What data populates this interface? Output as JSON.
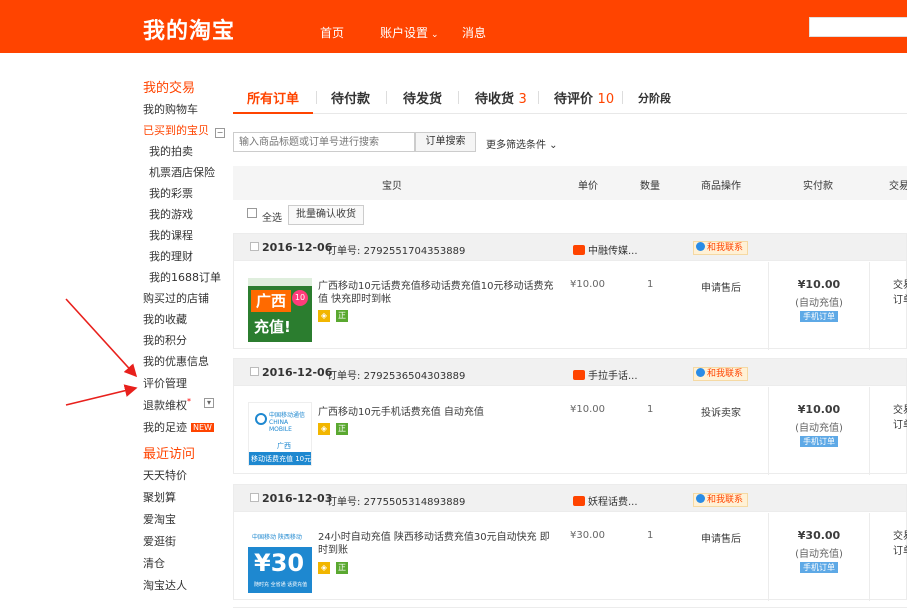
{
  "header": {
    "brand": "我的淘宝",
    "nav": [
      {
        "label": "首页",
        "arrow": ""
      },
      {
        "label": "账户设置",
        "arrow": "⌄"
      },
      {
        "label": "消息",
        "arrow": ""
      }
    ],
    "accent_color": "#ff4400"
  },
  "sidebar": {
    "trade_heading": "我的交易",
    "items": [
      {
        "label": "我的购物车"
      },
      {
        "label": "已买到的宝贝"
      },
      {
        "label": "我的拍卖"
      },
      {
        "label": "机票酒店保险"
      },
      {
        "label": "我的彩票"
      },
      {
        "label": "我的游戏"
      },
      {
        "label": "我的课程"
      },
      {
        "label": "我的理财"
      },
      {
        "label": "我的1688订单"
      },
      {
        "label": "购买过的店铺"
      },
      {
        "label": "我的收藏"
      },
      {
        "label": "我的积分"
      },
      {
        "label": "我的优惠信息"
      },
      {
        "label": "评价管理"
      },
      {
        "label": "退款维权"
      },
      {
        "label": "我的足迹"
      }
    ],
    "collapse_icon": "−",
    "expand_icon": "▾",
    "new_badge": "NEW",
    "recent_heading": "最近访问",
    "recent": [
      {
        "label": "天天特价"
      },
      {
        "label": "聚划算"
      },
      {
        "label": "爱淘宝"
      },
      {
        "label": "爱逛街"
      },
      {
        "label": "清仓"
      },
      {
        "label": "淘宝达人"
      }
    ]
  },
  "tabs": [
    {
      "label": "所有订单",
      "count": ""
    },
    {
      "label": "待付款",
      "count": ""
    },
    {
      "label": "待发货",
      "count": ""
    },
    {
      "label": "待收货",
      "count": "3"
    },
    {
      "label": "待评价",
      "count": "10"
    },
    {
      "label": "分阶段",
      "count": ""
    }
  ],
  "search": {
    "placeholder": "输入商品标题或订单号进行搜索",
    "button": "订单搜索",
    "more_filters": "更多筛选条件 ⌄"
  },
  "table_header": [
    "宝贝",
    "单价",
    "数量",
    "商品操作",
    "实付款",
    "交易"
  ],
  "select_all": "全选",
  "bulk_confirm": "批量确认收货",
  "order_no_label": "订单号:",
  "contact_label": "和我联系",
  "mobile_order_label": "手机订单",
  "orders": [
    {
      "date": "2016-12-06",
      "order_no": "2792551704353889",
      "shop": "中融传媒...",
      "title": "广西移动10元话费充值移动话费充值10元移动话费充值 快充即时到帐",
      "price": "¥10.00",
      "qty": "1",
      "op": "申请售后",
      "paid": "¥10.00",
      "auto": "(自动充值)",
      "status": [
        "交易",
        "订单"
      ],
      "thumb": {
        "line1": "广西",
        "badge": "10",
        "line2": "充值!"
      }
    },
    {
      "date": "2016-12-06",
      "order_no": "2792536504303889",
      "shop": "手拉手话...",
      "title": "广西移动10元手机话费充值 自动充值",
      "price": "¥10.00",
      "qty": "1",
      "op": "投诉卖家",
      "paid": "¥10.00",
      "auto": "(自动充值)",
      "status": [
        "交易",
        "订单"
      ],
      "thumb": {
        "brand": "中国移动通信 CHINA MOBILE",
        "region": "广西",
        "bar": "移动话费充值 10元"
      }
    },
    {
      "date": "2016-12-03",
      "order_no": "2775505314893889",
      "shop": "妖程话费...",
      "title": "24小时自动充值 陕西移动话费充值30元自动快充 即时到账",
      "price": "¥30.00",
      "qty": "1",
      "op": "申请售后",
      "paid": "¥30.00",
      "auto": "(自动充值)",
      "status": [
        "交易",
        "订单"
      ],
      "thumb": {
        "top": "中国移动   陕西移动",
        "amount": "¥30",
        "small": "随时充 全省通 话费充值"
      }
    }
  ],
  "tags": {
    "yellow": "◈",
    "green": "正"
  }
}
